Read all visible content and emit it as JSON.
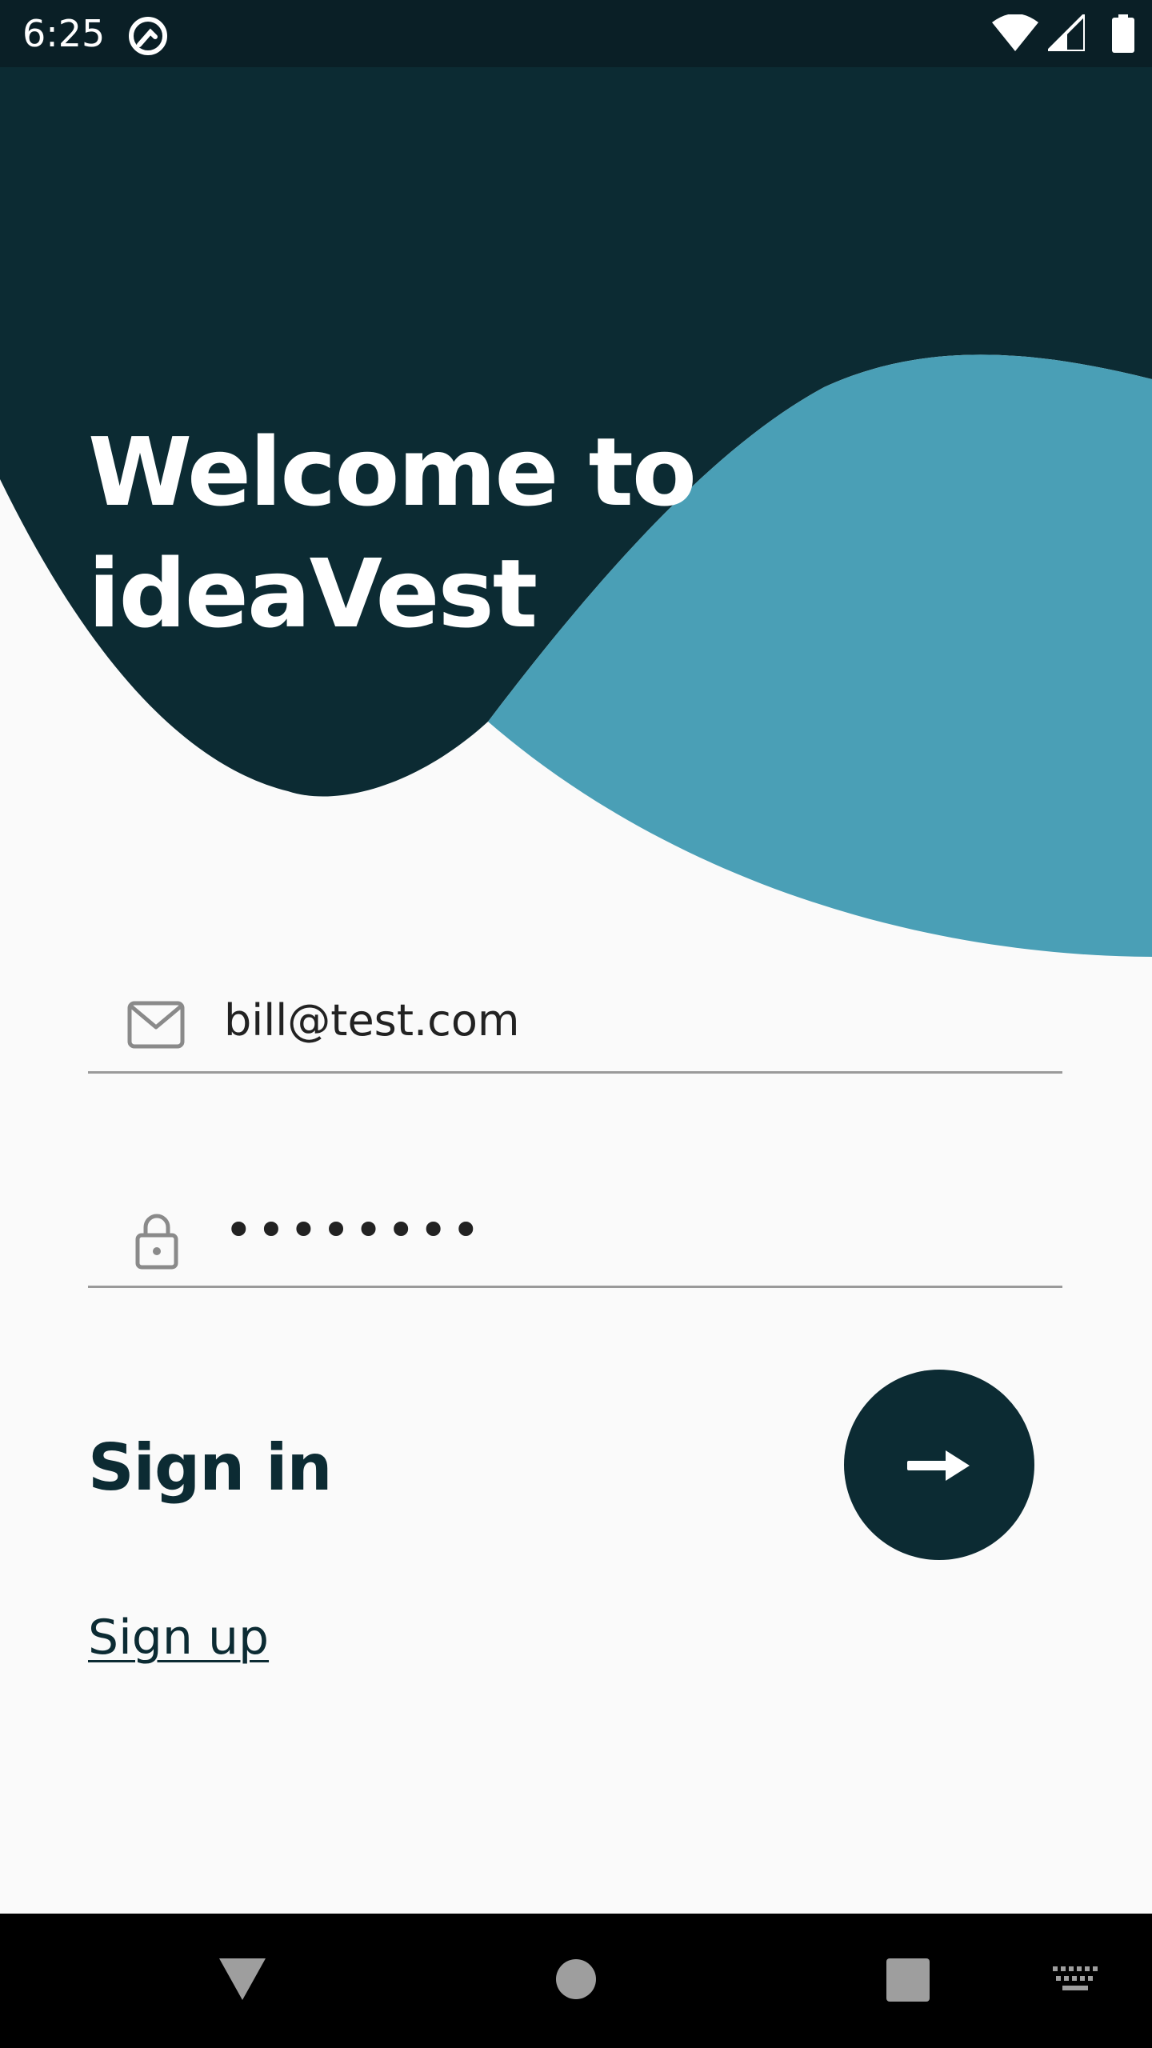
{
  "status_bar": {
    "time": "6:25",
    "icons": [
      "app-notification-icon",
      "wifi-icon",
      "signal-icon",
      "battery-icon"
    ]
  },
  "hero": {
    "title": "Welcome to\nideaVest",
    "colors": {
      "dark": "#0c2b33",
      "wave": "#4a9fb6"
    }
  },
  "login_form": {
    "email": {
      "icon": "mail-icon",
      "value": "bill@test.com",
      "placeholder": ""
    },
    "password": {
      "icon": "lock-icon",
      "masked_value": "••••••••"
    }
  },
  "actions": {
    "sign_in_label": "Sign in",
    "sign_in_button_icon": "arrow-right-icon",
    "sign_up_link": "Sign up"
  },
  "nav_bar": {
    "buttons": [
      "back-icon",
      "home-icon",
      "recents-icon",
      "keyboard-icon"
    ]
  },
  "theme": {
    "background": "#fafafa",
    "primary": "#0c2b33",
    "accent": "#4a9fb6",
    "divider": "#9a9a9a"
  }
}
